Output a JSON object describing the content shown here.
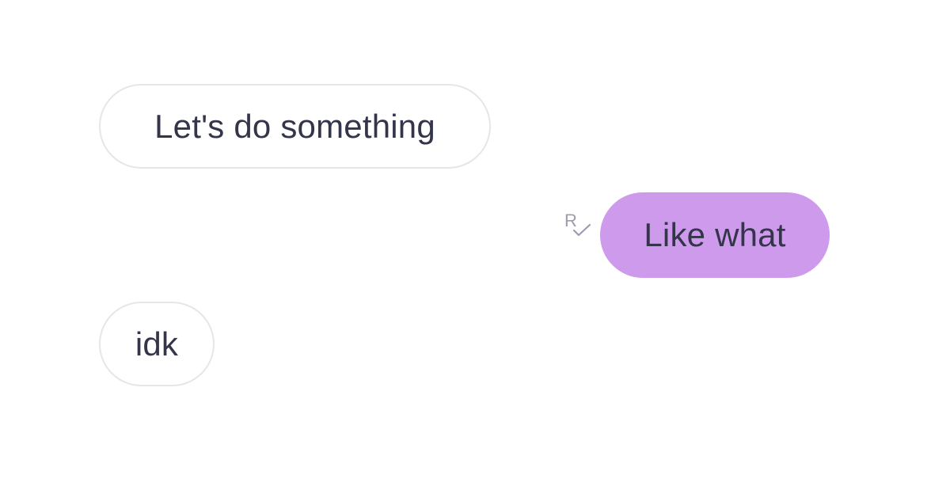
{
  "conversation": {
    "messages": [
      {
        "direction": "incoming",
        "text": "Let's do something"
      },
      {
        "direction": "outgoing",
        "text": "Like what",
        "read_receipt": {
          "icon": "read-receipt-icon",
          "letter": "R"
        }
      },
      {
        "direction": "incoming",
        "text": "idk"
      }
    ]
  },
  "colors": {
    "background": "#ffffff",
    "incoming_bubble_fill": "#ffffff",
    "incoming_bubble_border": "#e6e6ea",
    "outgoing_bubble_fill": "#cd9aec",
    "message_text": "#34354a",
    "receipt_icon": "#9a9db0"
  }
}
